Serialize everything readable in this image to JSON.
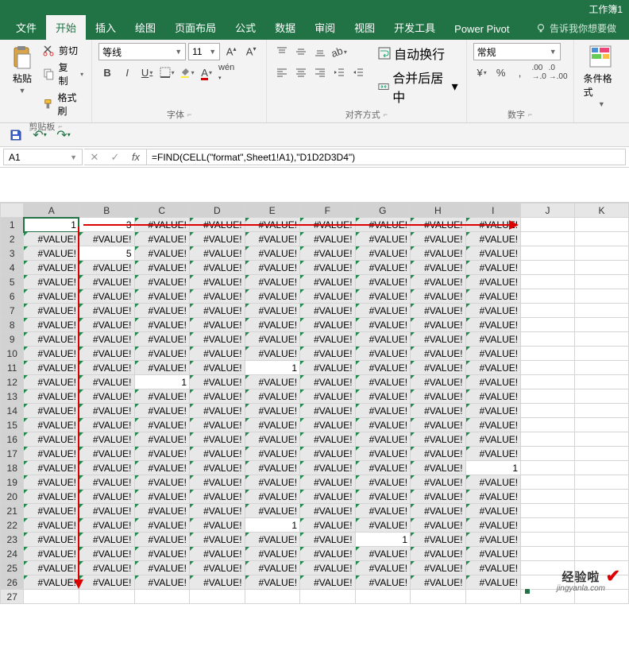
{
  "title": "工作簿1",
  "tabs": [
    "文件",
    "开始",
    "插入",
    "绘图",
    "页面布局",
    "公式",
    "数据",
    "审阅",
    "视图",
    "开发工具",
    "Power Pivot"
  ],
  "active_tab": 1,
  "tell_me": "告诉我你想要做",
  "clipboard": {
    "paste": "粘贴",
    "cut": "剪切",
    "copy": "复制",
    "painter": "格式刷",
    "group": "剪贴板"
  },
  "font": {
    "name": "等线",
    "size": "11",
    "group": "字体",
    "bold": "B",
    "italic": "I",
    "underline": "U",
    "bigger": "A",
    "smaller": "A"
  },
  "alignment": {
    "wrap": "自动换行",
    "merge": "合并后居中",
    "group": "对齐方式"
  },
  "number": {
    "format": "常规",
    "group": "数字"
  },
  "styles": {
    "cf": "条件格式",
    "group": ""
  },
  "name_box": "A1",
  "formula": "=FIND(CELL(\"format\",Sheet1!A1),\"D1D2D3D4\")",
  "cols": [
    "A",
    "B",
    "C",
    "D",
    "E",
    "F",
    "G",
    "H",
    "I",
    "J",
    "K"
  ],
  "rows": 27,
  "err": "#VALUE!",
  "chart_data": {
    "type": "table",
    "active_cell": "A1",
    "selection": "A1:I26",
    "numeric_cells": {
      "A1": 1,
      "B1": 3,
      "B3": 5,
      "C12": 1,
      "E11": 1,
      "E22": 1,
      "G23": 1,
      "I18": 1
    },
    "error_default": "#VALUE!",
    "rows_shown": 26,
    "cols_filled": 9
  },
  "watermark": {
    "l1": "经验啦",
    "l2": "jingyanla.com"
  }
}
